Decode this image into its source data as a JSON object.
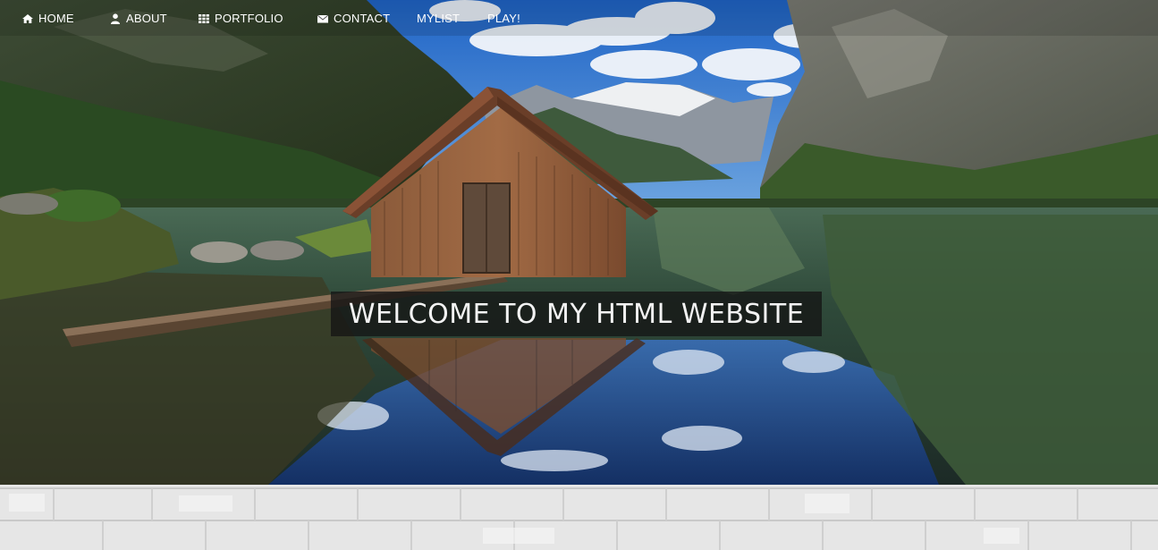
{
  "nav": {
    "items": [
      {
        "label": "HOME",
        "icon": "home-icon"
      },
      {
        "label": "ABOUT",
        "icon": "user-icon"
      },
      {
        "label": "PORTFOLIO",
        "icon": "grid-icon"
      },
      {
        "label": "CONTACT",
        "icon": "envelope-icon"
      },
      {
        "label": "MYLIST",
        "icon": ""
      },
      {
        "label": "PLAY!",
        "icon": ""
      }
    ]
  },
  "hero": {
    "title": "WELCOME TO MY HTML WEBSITE",
    "image": "boathouse-mountain-lake-photo"
  },
  "colors": {
    "nav_text": "#ffffff",
    "title_bg": "#141414",
    "title_text": "#f2f2f2",
    "brick_wall": "#e9e9e9"
  }
}
